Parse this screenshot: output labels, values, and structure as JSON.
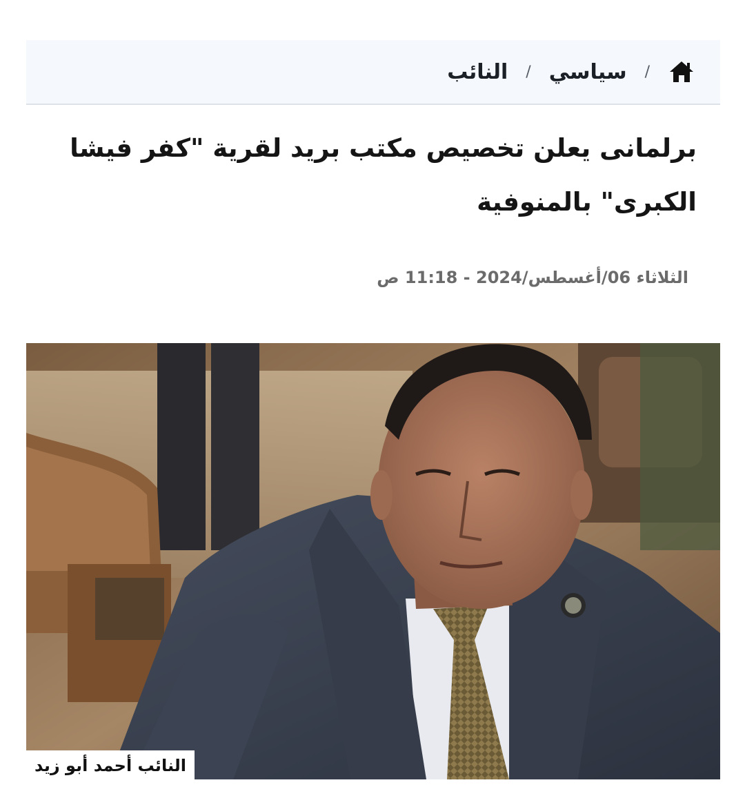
{
  "breadcrumb": {
    "home_icon": "home-icon",
    "separator": "/",
    "items": [
      {
        "label": "سياسي"
      },
      {
        "label": "النائب"
      }
    ]
  },
  "article": {
    "title": "برلمانى يعلن تخصيص مكتب بريد لقرية \"كفر فيشا الكبرى\" بالمنوفية",
    "date": "الثلاثاء 06/أغسطس/2024 - 11:18 ص",
    "image_caption": "النائب أحمد أبو زيد"
  },
  "colors": {
    "breadcrumb_bg": "#f5f9fd",
    "title_text": "#151515",
    "date_text": "#6b6b6b",
    "suit": "#3a4150",
    "tie": "#8e7a4c"
  }
}
